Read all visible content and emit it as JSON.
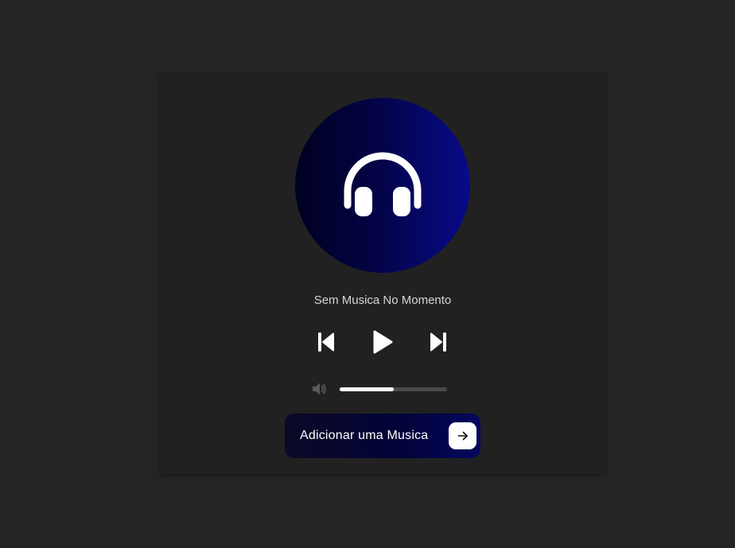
{
  "player": {
    "song_title": "Sem Musica No Momento",
    "artwork_icon": "headphones-icon",
    "controls": {
      "previous_icon": "skip-previous-icon",
      "play_icon": "play-icon",
      "next_icon": "skip-next-icon"
    },
    "volume": {
      "icon": "volume-icon",
      "level_percent": 50
    },
    "add_button": {
      "label": "Adicionar uma Musica",
      "icon": "arrow-right-icon"
    }
  },
  "colors": {
    "page_background": "#242424",
    "card_background": "#212121",
    "accent_dark": "#000021",
    "accent_light": "#080a8a",
    "text": "#d6d6d6"
  }
}
